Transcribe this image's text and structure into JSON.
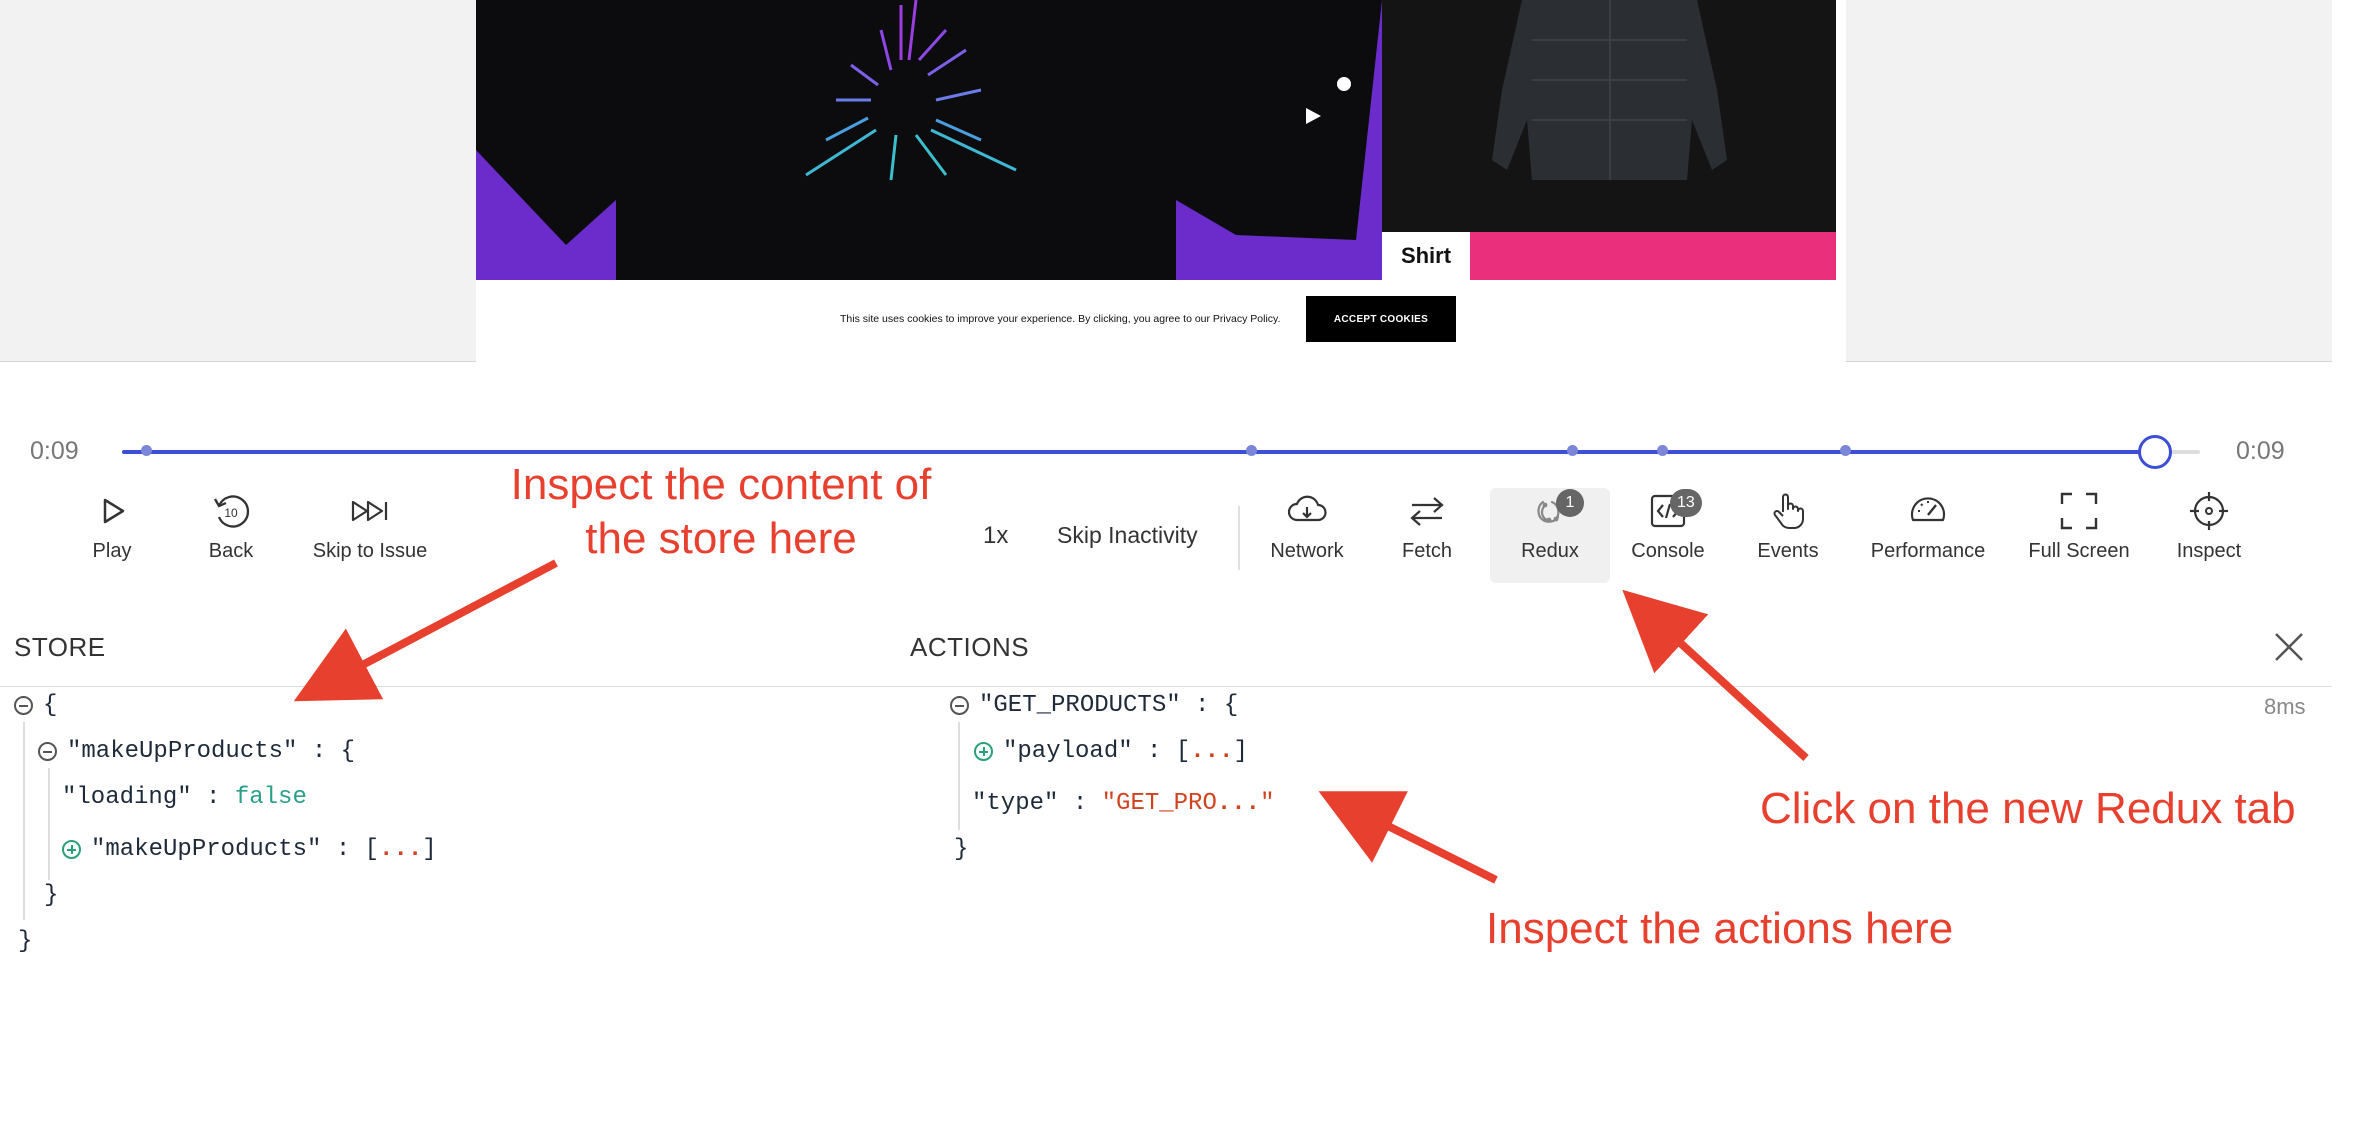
{
  "preview": {
    "product_label": "Shirt",
    "cookie_text": "This site uses cookies to improve your experience. By clicking, you agree to our Privacy Policy.",
    "cookie_button": "ACCEPT COOKIES",
    "colors": {
      "tee_bg": "#6b2ccb",
      "strip": "#ea2f7c",
      "jacket_bg": "#141414"
    }
  },
  "timeline": {
    "current_time": "0:09",
    "total_time": "0:09",
    "progress": 0.98,
    "accent": "#3d4fd6"
  },
  "toolbar": {
    "play": "Play",
    "back": "Back",
    "back_icon_number": "10",
    "skip_to_issue": "Skip to Issue",
    "speed": "1x",
    "skip_inactivity": "Skip Inactivity",
    "network": "Network",
    "fetch": "Fetch",
    "redux": "Redux",
    "redux_badge": "1",
    "console": "Console",
    "console_badge": "13",
    "events": "Events",
    "performance": "Performance",
    "full_screen": "Full Screen",
    "inspect": "Inspect",
    "active_tab": "Redux"
  },
  "store": {
    "heading": "STORE",
    "open_brace": "{",
    "key_outer": "\"makeUpProducts\"",
    "colon_brace": " : {",
    "key_loading": "\"loading\"",
    "colon": " : ",
    "loading_value": "false",
    "key_inner": "\"makeUpProducts\"",
    "colon_bracket": " : [",
    "ellipsis": "...",
    "close_bracket": "]",
    "close_brace": "}"
  },
  "actions": {
    "heading": "ACTIONS",
    "action_key": "\"GET_PRODUCTS\"",
    "colon_brace": " : {",
    "timing": "8ms",
    "payload_key": "\"payload\"",
    "colon_bracket": " : [",
    "ellipsis": "...",
    "close_bracket": "]",
    "type_key": "\"type\"",
    "colon": " : ",
    "type_value_start": "\"GET_PRO",
    "type_ellipsis": "...",
    "type_value_end": "\"",
    "close_brace": "}"
  },
  "annotations": {
    "store_line1": "Inspect the content of",
    "store_line2": "the store here",
    "redux_tab": "Click on the new Redux tab",
    "actions": "Inspect the actions here",
    "color": "#e8402f"
  }
}
